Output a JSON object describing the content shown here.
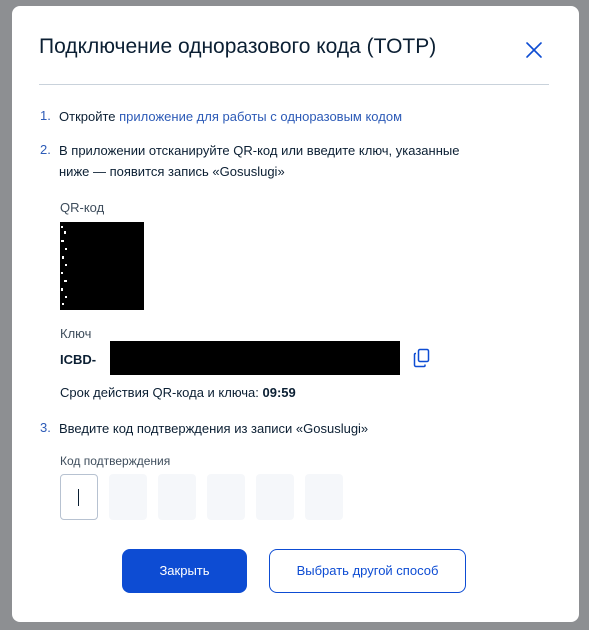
{
  "modal": {
    "title": "Подключение одноразового кода (TOTP)",
    "close_icon": "close-icon"
  },
  "steps": [
    {
      "number": "1.",
      "text_before": "Откройте ",
      "link": "приложение для работы с одноразовым кодом"
    },
    {
      "number": "2.",
      "line1": "В приложении отсканируйте QR-код или введите ключ, указанные",
      "line2": "ниже — появится запись «Gosuslugi»"
    },
    {
      "number": "3.",
      "text": "Введите код подтверждения из записи «Gosuslugi»"
    }
  ],
  "qr": {
    "label": "QR-код"
  },
  "key": {
    "label": "Ключ",
    "prefix": "ICBD-",
    "copy_icon": "copy-icon"
  },
  "expiry": {
    "label": "Срок действия QR-кода и ключа: ",
    "value": "09:59"
  },
  "code": {
    "label": "Код подтверждения",
    "digits": [
      "",
      "",
      "",
      "",
      "",
      ""
    ]
  },
  "buttons": {
    "close": "Закрыть",
    "other_method": "Выбрать другой способ"
  },
  "colors": {
    "primary": "#0d4cd3",
    "link": "#2d5bb7",
    "text": "#0b1f33",
    "backdrop": "#8d8f92"
  }
}
